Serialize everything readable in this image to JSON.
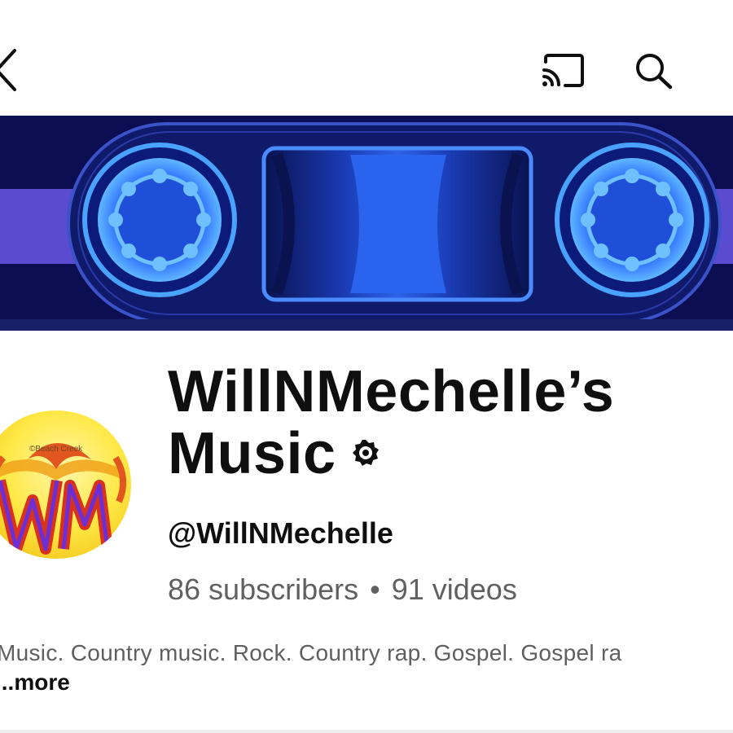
{
  "toolbar": {
    "back_icon": "chevron-left-icon",
    "cast_icon": "cast-icon",
    "search_icon": "search-icon"
  },
  "banner": {
    "image": "cassette-tape-banner",
    "colors": {
      "background": "#0b0f52",
      "accent": "#3f8cff",
      "stripe": "#6b57d8"
    }
  },
  "avatar": {
    "image": "channel-logo-wm",
    "watermark": "©Beach Creek",
    "lettering": "WM"
  },
  "channel": {
    "name_line1": "WillNMechelle’s",
    "name_line2": "Music",
    "verified_icon": "verified-badge-icon",
    "handle": "@WillNMechelle",
    "subscribers": "86 subscribers",
    "separator": "•",
    "videos": "91 videos"
  },
  "description": {
    "text": "Music.  Country music.  Rock.  Country rap.  Gospel.  Gospel ra",
    "more_label": "...more"
  }
}
